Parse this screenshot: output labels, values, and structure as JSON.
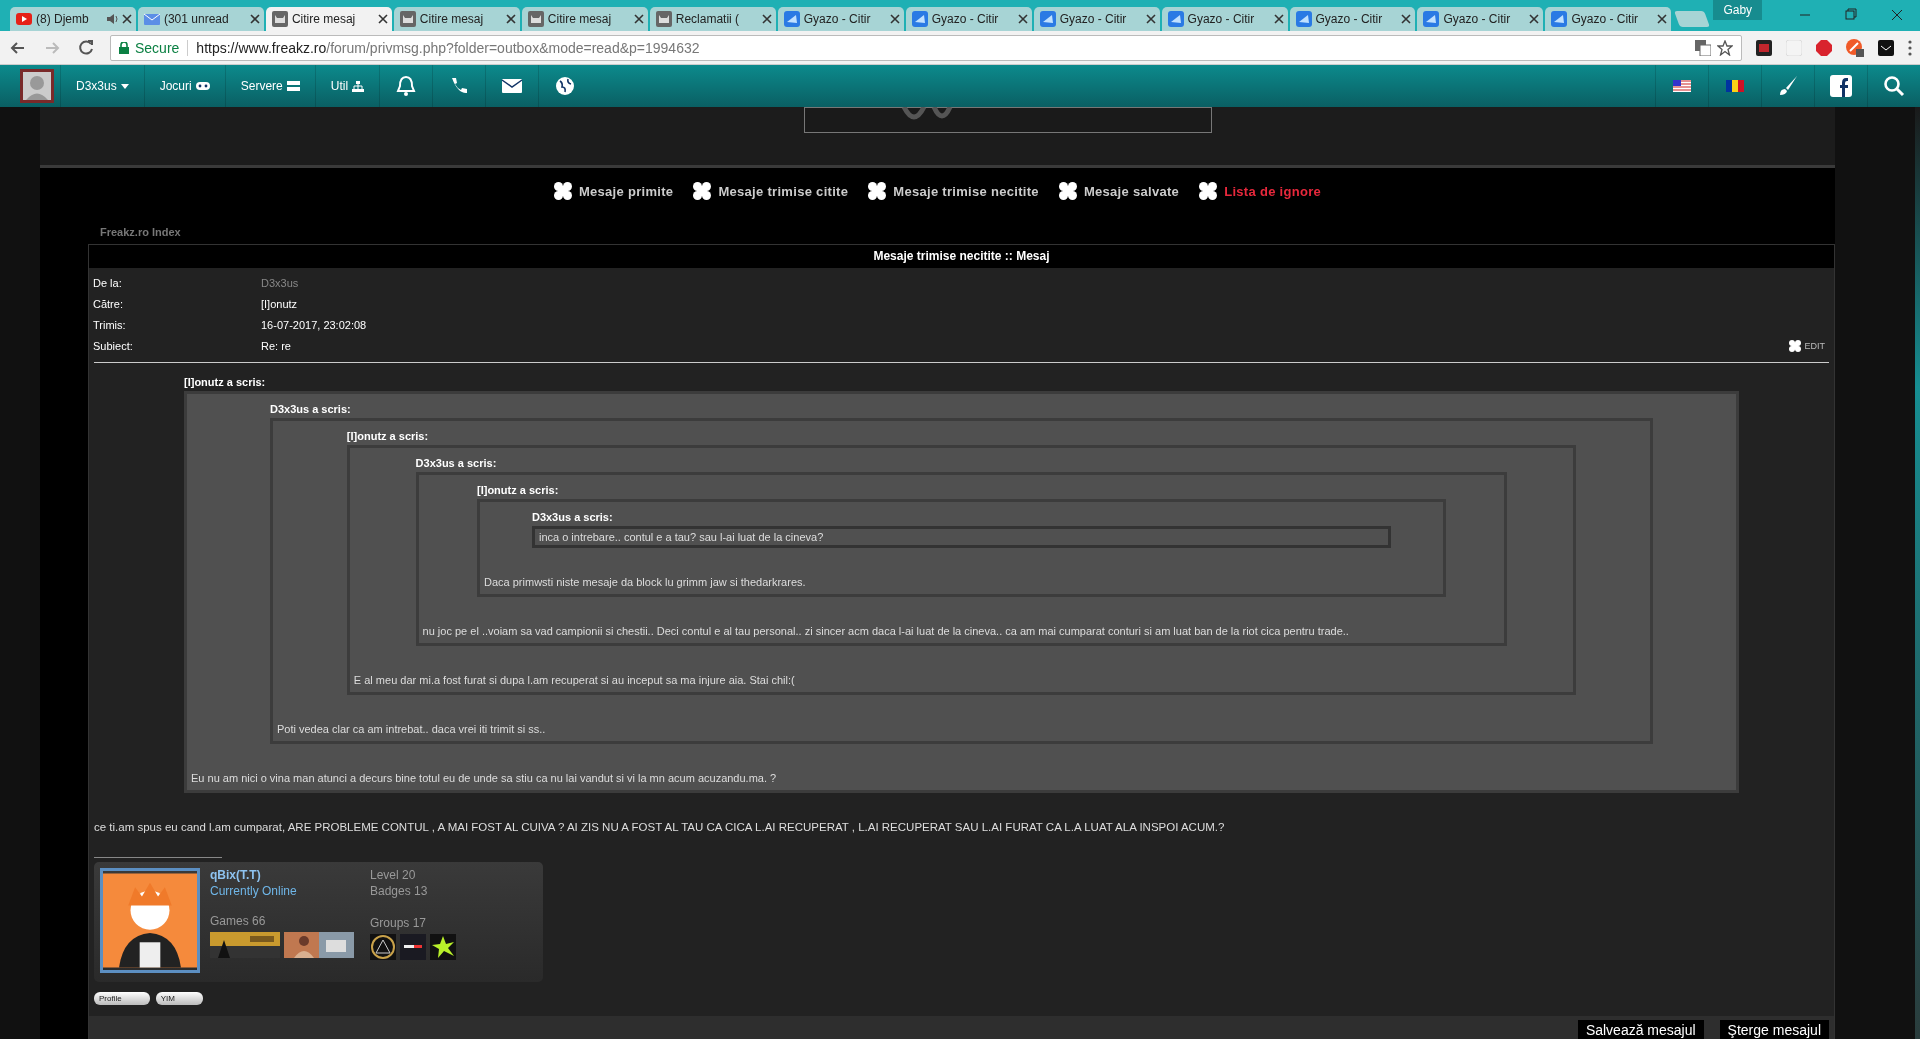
{
  "browser": {
    "tabs": [
      {
        "title": "(8) Djemb",
        "kind": "video",
        "audio": true,
        "selected": false
      },
      {
        "title": "(301 unread",
        "kind": "mail",
        "audio": false,
        "selected": false
      },
      {
        "title": "Citire mesaj",
        "kind": "forum",
        "audio": false,
        "selected": true
      },
      {
        "title": "Citire mesaj",
        "kind": "forum",
        "audio": false,
        "selected": false
      },
      {
        "title": "Citire mesaj",
        "kind": "forum",
        "audio": false,
        "selected": false
      },
      {
        "title": "Reclamatii (",
        "kind": "forum",
        "audio": false,
        "selected": false
      },
      {
        "title": "Gyazo - Citir",
        "kind": "gyazo",
        "audio": false,
        "selected": false
      },
      {
        "title": "Gyazo - Citir",
        "kind": "gyazo",
        "audio": false,
        "selected": false
      },
      {
        "title": "Gyazo - Citir",
        "kind": "gyazo",
        "audio": false,
        "selected": false
      },
      {
        "title": "Gyazo - Citir",
        "kind": "gyazo",
        "audio": false,
        "selected": false
      },
      {
        "title": "Gyazo - Citir",
        "kind": "gyazo",
        "audio": false,
        "selected": false
      },
      {
        "title": "Gyazo - Citir",
        "kind": "gyazo",
        "audio": false,
        "selected": false
      },
      {
        "title": "Gyazo - Citir",
        "kind": "gyazo",
        "audio": false,
        "selected": false
      }
    ],
    "profile": "Gaby",
    "address": {
      "security": "Secure",
      "origin": "https://www.freakz.ro",
      "path": "/forum/privmsg.php?folder=outbox&mode=read&p=1994632"
    }
  },
  "site_nav": {
    "user": "D3x3us",
    "items": [
      {
        "label": "Jocuri",
        "kind": "gamepad"
      },
      {
        "label": "Servere",
        "kind": "server"
      },
      {
        "label": "Util",
        "kind": "sitemap"
      }
    ]
  },
  "folders": [
    {
      "label": "Mesaje primite",
      "color": "#cccccc"
    },
    {
      "label": "Mesaje trimise citite",
      "color": "#cccccc"
    },
    {
      "label": "Mesaje trimise necitite",
      "color": "#cccccc"
    },
    {
      "label": "Mesaje salvate",
      "color": "#cccccc"
    },
    {
      "label": "Lista de ignore",
      "color": "#e8283c"
    }
  ],
  "breadcrumb": "Freakz.ro Index",
  "message": {
    "title": "Mesaje trimise necitite :: Mesaj",
    "fields": [
      {
        "label": "De la:",
        "value": "D3x3us",
        "kind": "link"
      },
      {
        "label": "Către:",
        "value": "[I]onutz",
        "kind": "text"
      },
      {
        "label": "Trimis:",
        "value": "16-07-2017, 23:02:08",
        "kind": "text"
      },
      {
        "label": "Subiect:",
        "value": "Re: re",
        "kind": "text"
      }
    ],
    "edit": "EDIT",
    "quote": {
      "author": "[I]onutz a scris:",
      "text": "Eu nu am nici o vina man atunci a decurs bine totul eu de unde sa stiu ca nu lai vandut si vi la mn acum acuzandu.ma. ?",
      "quote": {
        "author": "D3x3us a scris:",
        "text": "Poti vedea clar ca am intrebat.. daca vrei iti trimit si ss..",
        "quote": {
          "author": "[I]onutz a scris:",
          "text": "E al meu dar mi.a fost furat si dupa l.am recuperat si au inceput sa ma injure aia. Stai chil:(",
          "quote": {
            "author": "D3x3us a scris:",
            "text": "nu joc pe el ..voiam sa vad campionii si chestii.. Deci contul e al tau personal.. zi sincer acm daca l-ai luat de la cineva.. ca am mai cumparat conturi si am luat ban de la riot cica pentru trade..",
            "quote": {
              "author": "[I]onutz a scris:",
              "text": "Daca primwsti niste mesaje da block lu grimm jaw si thedarkrares.",
              "quote": {
                "author": "D3x3us a scris:",
                "text": "inca o intrebare.. contul e a tau? sau l-ai luat de la cineva?"
              }
            }
          }
        }
      }
    },
    "text": "ce ti.am spus eu cand l.am cumparat, ARE PROBLEME CONTUL , A MAI FOST AL CUIVA ? AI ZIS NU A FOST AL TAU CA CICA L.AI RECUPERAT , L.AI RECUPERAT SAU L.AI FURAT CA L.A LUAT ALA INSPOI ACUM.?"
  },
  "signature": {
    "name": "qBix(T.T)",
    "status": "Currently Online",
    "level": "Level 20",
    "badges": "Badges 13",
    "games": "Games 66",
    "groups": "Groups 17",
    "buttons": [
      "Profile",
      "YIM"
    ]
  },
  "actions": [
    "Salvează mesajul",
    "Şterge mesajul"
  ]
}
